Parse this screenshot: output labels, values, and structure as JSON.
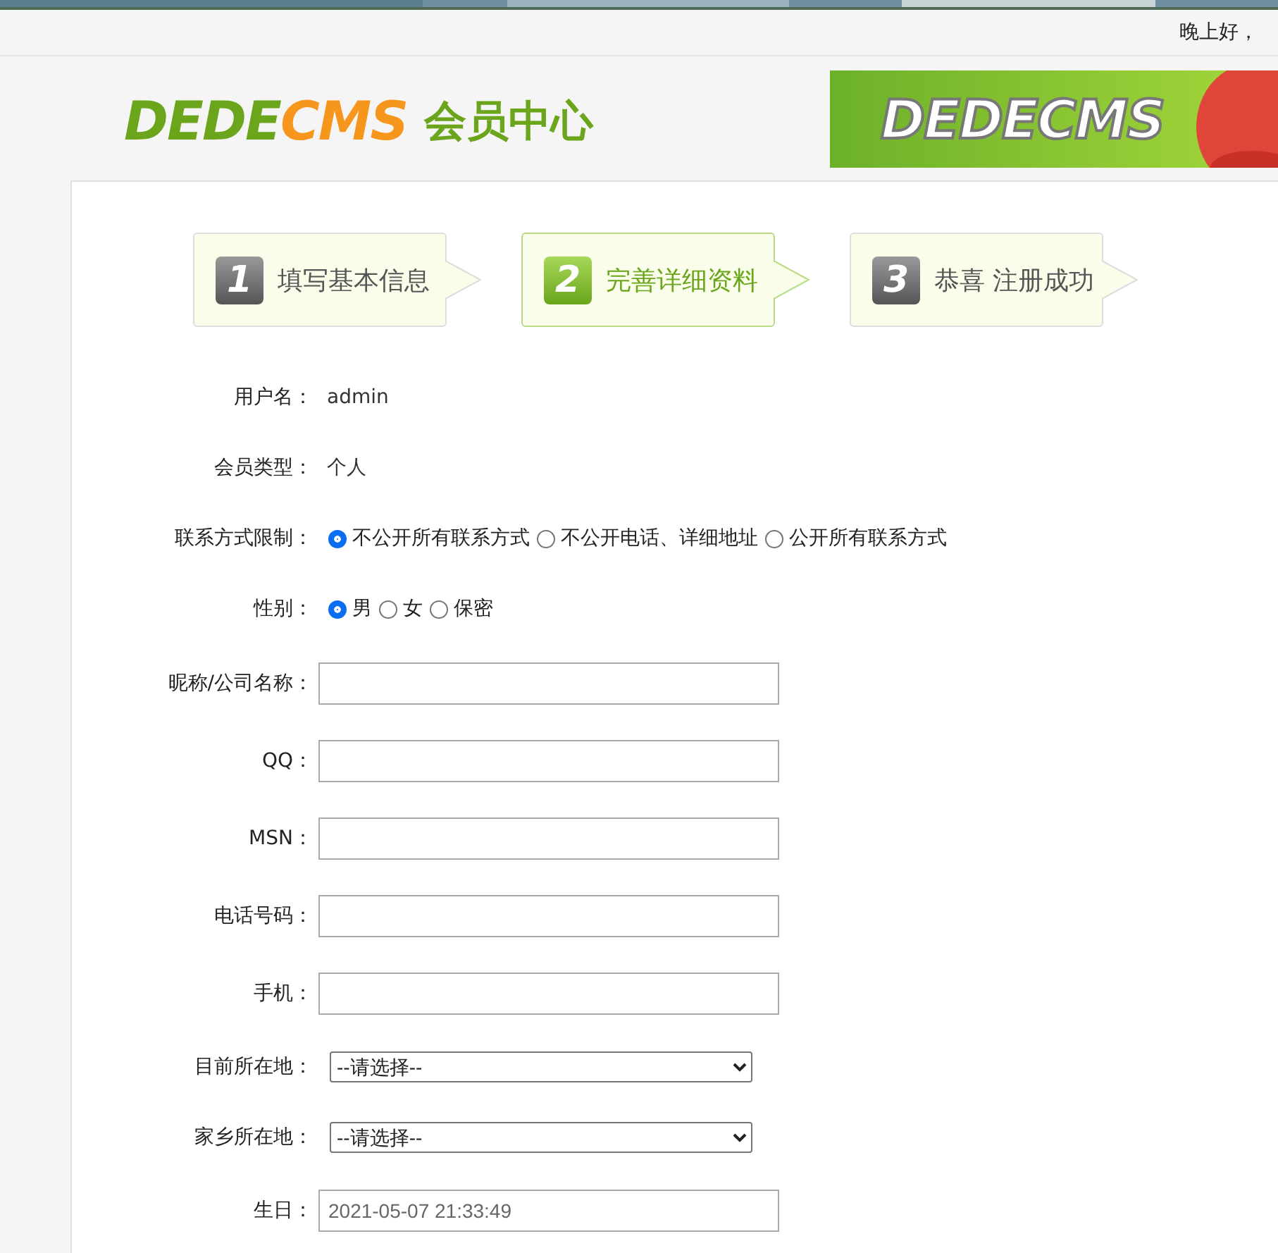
{
  "top_bar": {
    "greeting": "晚上好，"
  },
  "header": {
    "logo": {
      "part_1": "DEDE",
      "part_2": "CMS",
      "part_3": "会员中心"
    },
    "banner": {
      "text": "DEDECMS"
    }
  },
  "steps": [
    {
      "number": "1",
      "label": "填写基本信息",
      "selected": false
    },
    {
      "number": "2",
      "label": "完善详细资料",
      "selected": true
    },
    {
      "number": "3",
      "label": "恭喜 注册成功",
      "selected": false
    }
  ],
  "form": {
    "rows": [
      {
        "kind": "text",
        "label": "用户名：",
        "value": "admin"
      },
      {
        "kind": "text",
        "label": "会员类型：",
        "value": "个人"
      },
      {
        "kind": "radio",
        "label": "联系方式限制：",
        "options": [
          {
            "label": "不公开所有联系方式",
            "selected": true
          },
          {
            "label": "不公开电话、详细地址",
            "selected": false
          },
          {
            "label": "公开所有联系方式",
            "selected": false
          }
        ]
      },
      {
        "kind": "radio",
        "label": "性别：",
        "options": [
          {
            "label": "男",
            "selected": true
          },
          {
            "label": "女",
            "selected": false
          },
          {
            "label": "保密",
            "selected": false
          }
        ]
      },
      {
        "kind": "input",
        "label": "昵称/公司名称："
      },
      {
        "kind": "input",
        "label": "QQ："
      },
      {
        "kind": "input",
        "label": "MSN："
      },
      {
        "kind": "input",
        "label": "电话号码："
      },
      {
        "kind": "input",
        "label": "手机："
      },
      {
        "kind": "select",
        "label": "目前所在地：",
        "value": "--请选择--"
      },
      {
        "kind": "select",
        "label": "家乡所在地：",
        "value": "--请选择--"
      },
      {
        "kind": "date",
        "label": "生日：",
        "value": "2021-05-07 21:33:49"
      }
    ]
  }
}
